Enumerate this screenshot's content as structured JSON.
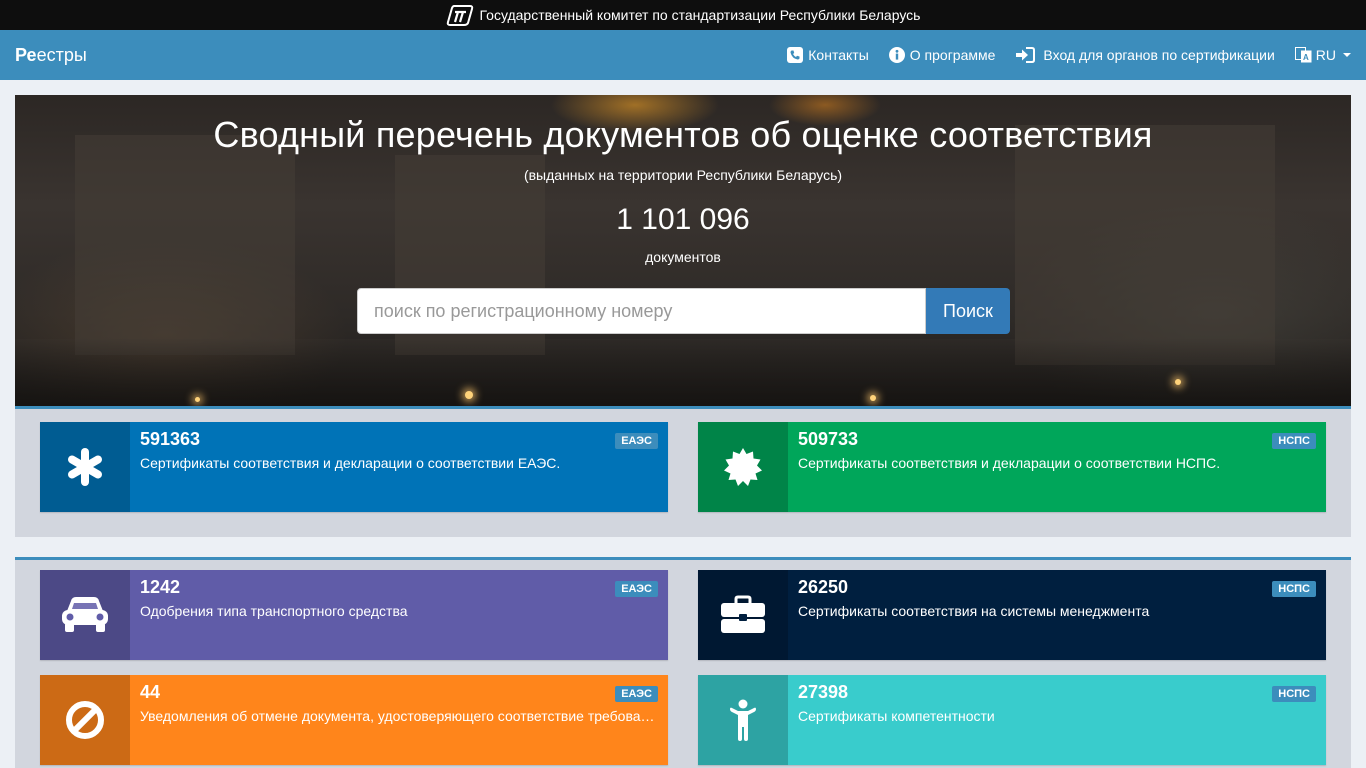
{
  "topbar": {
    "text": "Государственный комитет по стандартизации Республики Беларусь",
    "logo_icon": "gosstandart-logo-icon"
  },
  "navbar": {
    "brand_bold": "Ре",
    "brand_rest": "естры",
    "items": [
      {
        "label": "Контакты",
        "icon": "phone-icon"
      },
      {
        "label": "О программе",
        "icon": "info-icon"
      },
      {
        "label": "Вход для органов по сертификации",
        "icon": "sign-in-icon"
      }
    ],
    "language": {
      "label": "RU",
      "icon": "language-icon"
    }
  },
  "hero": {
    "title": "Сводный перечень документов об оценке соответствия",
    "subtitle": "(выданных на территории Республики Беларусь)",
    "count": "1 101 096",
    "count_label": "документов",
    "search": {
      "placeholder": "поиск по регистрационному номеру",
      "value": "",
      "button": "Поиск"
    }
  },
  "boxes": [
    {
      "number": "591363",
      "description": "Сертификаты соответствия и декларации о соответствии ЕАЭС.",
      "badge": "ЕАЭС",
      "icon": "asterisk-icon",
      "color": "#0073b7"
    },
    {
      "number": "509733",
      "description": "Сертификаты соответствия и декларации о соответствии НСПС.",
      "badge": "НСПС",
      "icon": "certificate-icon",
      "color": "#00a65a"
    },
    {
      "number": "1242",
      "description": "Одобрения типа транспортного средства",
      "badge": "ЕАЭС",
      "icon": "car-icon",
      "color": "#605ca8"
    },
    {
      "number": "26250",
      "description": "Сертификаты соответствия на системы менеджмента",
      "badge": "НСПС",
      "icon": "briefcase-icon",
      "color": "#001f3f"
    },
    {
      "number": "44",
      "description": "Уведомления об отмене документа, удостоверяющего соответствие требованиям технических регламентов",
      "badge": "ЕАЭС",
      "icon": "ban-icon",
      "color": "#ff851b"
    },
    {
      "number": "27398",
      "description": "Сертификаты компетентности",
      "badge": "НСПС",
      "icon": "person-icon",
      "color": "#39cccc"
    }
  ]
}
